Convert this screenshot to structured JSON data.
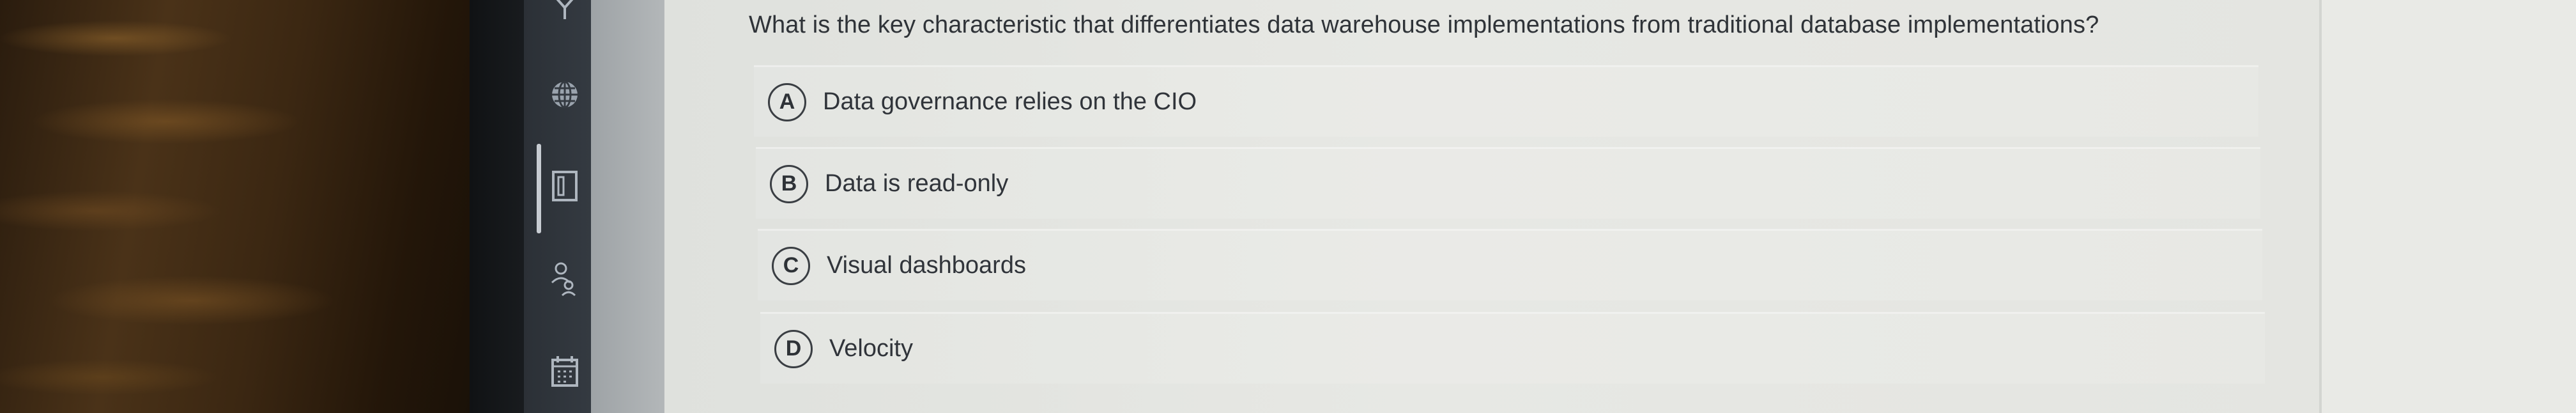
{
  "question": {
    "text": "What is the key characteristic that differentiates data warehouse implementations from traditional database implementations?"
  },
  "options": [
    {
      "letter": "A",
      "text": "Data governance relies on the CIO"
    },
    {
      "letter": "B",
      "text": "Data is read-only"
    },
    {
      "letter": "C",
      "text": "Visual dashboards"
    },
    {
      "letter": "D",
      "text": "Velocity"
    }
  ],
  "sidebar": {
    "icons": [
      "partial-top-icon",
      "globe-icon",
      "book-icon",
      "people-icon",
      "calendar-icon"
    ]
  }
}
